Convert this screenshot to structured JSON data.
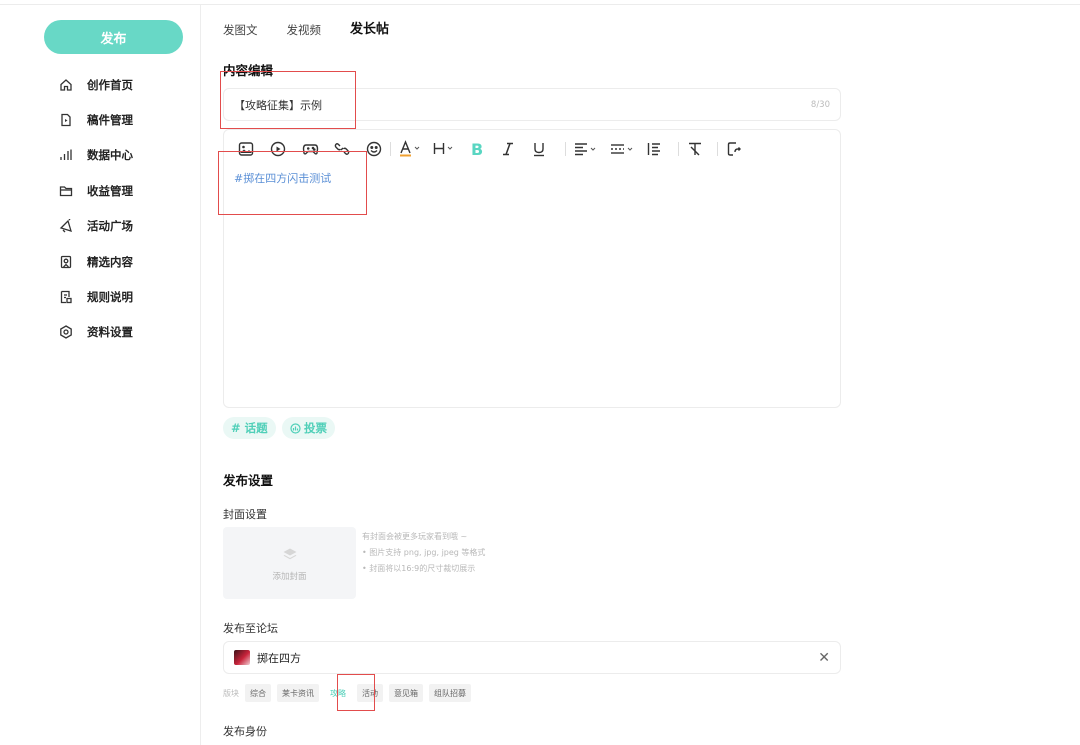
{
  "sidebar": {
    "publish_label": "发布",
    "items": [
      {
        "label": "创作首页",
        "icon": "home-icon"
      },
      {
        "label": "稿件管理",
        "icon": "file-icon"
      },
      {
        "label": "数据中心",
        "icon": "chart-icon"
      },
      {
        "label": "收益管理",
        "icon": "folder-icon"
      },
      {
        "label": "活动广场",
        "icon": "megaphone-icon"
      },
      {
        "label": "精选内容",
        "icon": "bookmark-icon"
      },
      {
        "label": "规则说明",
        "icon": "document-icon"
      },
      {
        "label": "资料设置",
        "icon": "gear-icon"
      }
    ]
  },
  "tabs": [
    "发图文",
    "发视频",
    "发长帖"
  ],
  "active_tab": "发长帖",
  "editor": {
    "section_title": "内容编辑",
    "title_value": "【攻略征集】示例",
    "title_count": "8/30",
    "body_text": "#掷在四方闪击测试",
    "toolbar_icons": [
      "image-icon",
      "video-icon",
      "gamepad-icon",
      "link-icon",
      "emoji-icon",
      "text-color-icon",
      "heading-icon",
      "bold-icon",
      "italic-icon",
      "underline-icon",
      "align-icon",
      "divider-icon",
      "list-icon",
      "clear-format-icon",
      "redo-icon"
    ],
    "chips": {
      "topic": "# 话题",
      "vote": "投票"
    }
  },
  "publish_settings": {
    "section_title": "发布设置",
    "cover_label": "封面设置",
    "cover_add": "添加封面",
    "cover_tips": [
      "有封面会被更多玩家看到哦 ~",
      "• 图片支持 png, jpg, jpeg 等格式",
      "• 封面将以16:9的尺寸裁切展示"
    ],
    "forum_label": "发布至论坛",
    "forum_name": "掷在四方",
    "board_label": "版块",
    "boards": [
      "综合",
      "莱卡资讯",
      "攻略",
      "活动",
      "意见箱",
      "组队招募"
    ],
    "selected_board": "攻略",
    "identity_label": "发布身份"
  },
  "colors": {
    "accent": "#68d8c6",
    "accent_text": "#4fcfb8",
    "highlight_box": "#e24c4c",
    "link": "#5a8fd6"
  }
}
